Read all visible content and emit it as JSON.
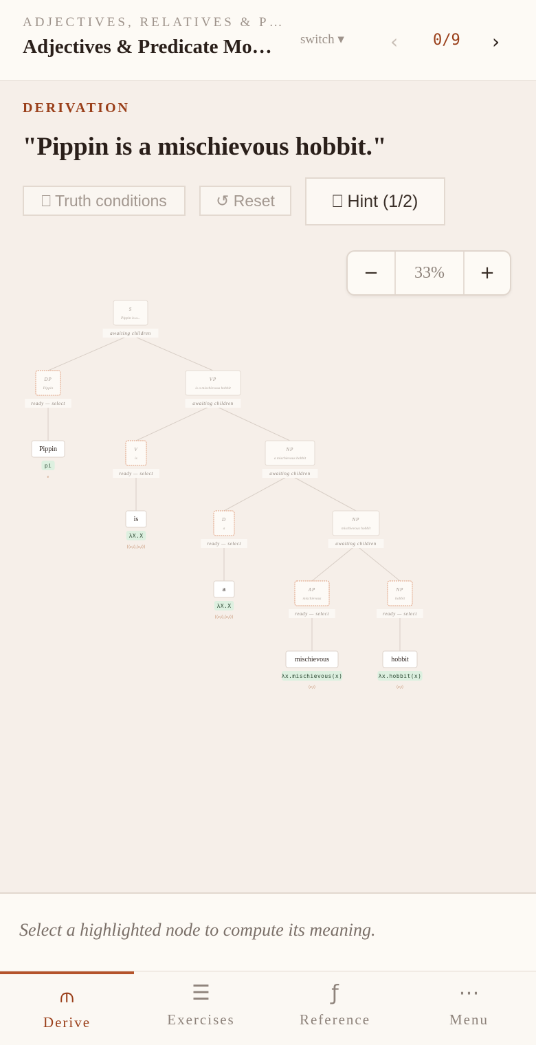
{
  "header": {
    "breadcrumb": "ADJECTIVES, RELATIVES & P…",
    "title": "Adjectives & Predicate Mo…",
    "switch_label": "switch ▾",
    "prev_icon": "‹",
    "counter": "0/9",
    "next_icon": "›"
  },
  "derivation": {
    "section_label": "DERIVATION",
    "sentence": "\"Pippin is a mischievous hobbit.\"",
    "truth_label": "⎕ Truth conditions",
    "reset_label": "↺ Reset",
    "hint_label": "⎕ Hint (1/2)"
  },
  "zoom": {
    "minus": "−",
    "level": "33%",
    "plus": "+"
  },
  "tree": {
    "nodes": [
      {
        "id": "s",
        "label": "S",
        "text": "Pippin is a...",
        "status": "awaiting children",
        "ready": false
      },
      {
        "id": "dp",
        "label": "DP",
        "text": "Pippin",
        "status": "ready — select",
        "ready": true
      },
      {
        "id": "vp",
        "label": "VP",
        "text": "is a mischievous hobbit",
        "status": "awaiting children",
        "ready": false
      },
      {
        "id": "v",
        "label": "V",
        "text": "is",
        "status": "ready — select",
        "ready": true
      },
      {
        "id": "np1",
        "label": "NP",
        "text": "a mischievous hobbit",
        "status": "awaiting children",
        "ready": false
      },
      {
        "id": "d",
        "label": "D",
        "text": "a",
        "status": "ready — select",
        "ready": true
      },
      {
        "id": "np2",
        "label": "NP",
        "text": "mischievous hobbit",
        "status": "awaiting children",
        "ready": false
      },
      {
        "id": "ap",
        "label": "AP",
        "text": "mischievous",
        "status": "ready — select",
        "ready": true
      },
      {
        "id": "np3",
        "label": "NP",
        "text": "hobbit",
        "status": "ready — select",
        "ready": true
      }
    ],
    "leaves": [
      {
        "id": "l-pippin",
        "word": "Pippin",
        "meaning": "pi",
        "type": "e"
      },
      {
        "id": "l-is",
        "word": "is",
        "meaning": "λX.X",
        "type": "⟨⟨e,t⟩,⟨e,t⟩⟩"
      },
      {
        "id": "l-a",
        "word": "a",
        "meaning": "λX.X",
        "type": "⟨⟨e,t⟩,⟨e,t⟩⟩"
      },
      {
        "id": "l-misch",
        "word": "mischievous",
        "meaning": "λx.mischievous(x)",
        "type": "⟨e,t⟩"
      },
      {
        "id": "l-hobbit",
        "word": "hobbit",
        "meaning": "λx.hobbit(x)",
        "type": "⟨e,t⟩"
      }
    ]
  },
  "status": {
    "message": "Select a highlighted node to compute its meaning."
  },
  "tabs": [
    {
      "icon": "⫙",
      "label": "Derive",
      "active": true
    },
    {
      "icon": "☰",
      "label": "Exercises",
      "active": false
    },
    {
      "icon": "ƒ",
      "label": "Reference",
      "active": false
    },
    {
      "icon": "⋯",
      "label": "Menu",
      "active": false
    }
  ],
  "colors": {
    "accent": "#9a3f1a",
    "ready_border": "#e0a080",
    "meaning_bg": "#ddf0e0"
  }
}
